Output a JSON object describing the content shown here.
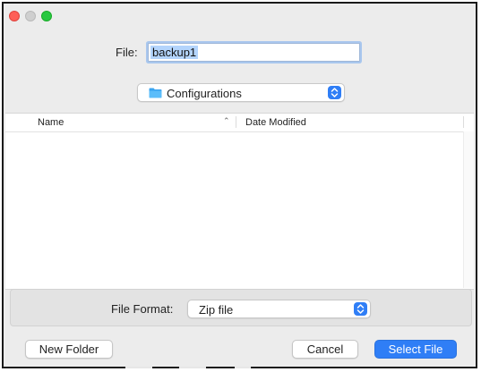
{
  "window": {
    "traffic_lights": [
      "close",
      "minimize",
      "zoom"
    ]
  },
  "file_row": {
    "label": "File:",
    "value": "backup1"
  },
  "location": {
    "icon": "folder-icon",
    "value": "Configurations"
  },
  "file_list": {
    "columns": [
      "Name",
      "Date Modified"
    ],
    "sort_indicator": "⌃",
    "rows": []
  },
  "format": {
    "label": "File Format:",
    "value": "Zip file"
  },
  "buttons": {
    "new_folder": "New Folder",
    "cancel": "Cancel",
    "select": "Select File"
  },
  "colors": {
    "accent": "#2f7ef6",
    "close": "#fe5f57",
    "zoom": "#28c840"
  }
}
